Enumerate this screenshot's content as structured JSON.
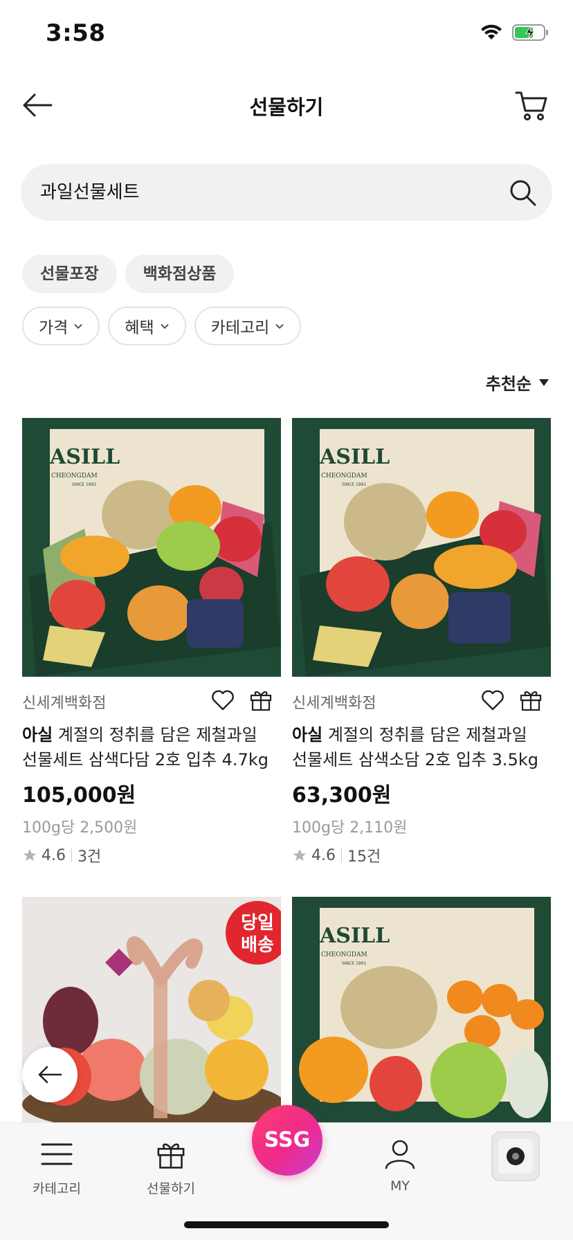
{
  "status_bar": {
    "time": "3:58"
  },
  "header": {
    "title": "선물하기"
  },
  "search": {
    "value": "과일선물세트"
  },
  "tags": [
    {
      "label": "선물포장"
    },
    {
      "label": "백화점상품"
    }
  ],
  "filters": [
    {
      "label": "가격"
    },
    {
      "label": "혜택"
    },
    {
      "label": "카테고리"
    }
  ],
  "sort": {
    "label": "추천순"
  },
  "products": [
    {
      "seller": "신세계백화점",
      "brand": "아실",
      "name_line1": "계절의 정취를 담은 제철과일",
      "name_line2": "선물세트 삼색다담 2호 입추 4.7kg",
      "price": "105,000원",
      "unit_price": "100g당 2,500원",
      "rating": "4.6",
      "reviews": "3건"
    },
    {
      "seller": "신세계백화점",
      "brand": "아실",
      "name_line1": "계절의 정취를 담은 제철과일",
      "name_line2": "선물세트 삼색소담 2호 입추 3.5kg",
      "price": "63,300원",
      "unit_price": "100g당 2,110원",
      "rating": "4.6",
      "reviews": "15건"
    },
    {
      "badge_line1": "당일",
      "badge_line2": "배송"
    },
    {}
  ],
  "image_text": {
    "brand": "ASILL",
    "sub": "CHEONGDAM",
    "since": "SINCE 1991"
  },
  "tab_bar": {
    "category": "카테고리",
    "gift": "선물하기",
    "ssg": "SSG",
    "my": "MY"
  },
  "colors": {
    "accent": "#ee2a8b",
    "box_green": "#1f4a35"
  }
}
